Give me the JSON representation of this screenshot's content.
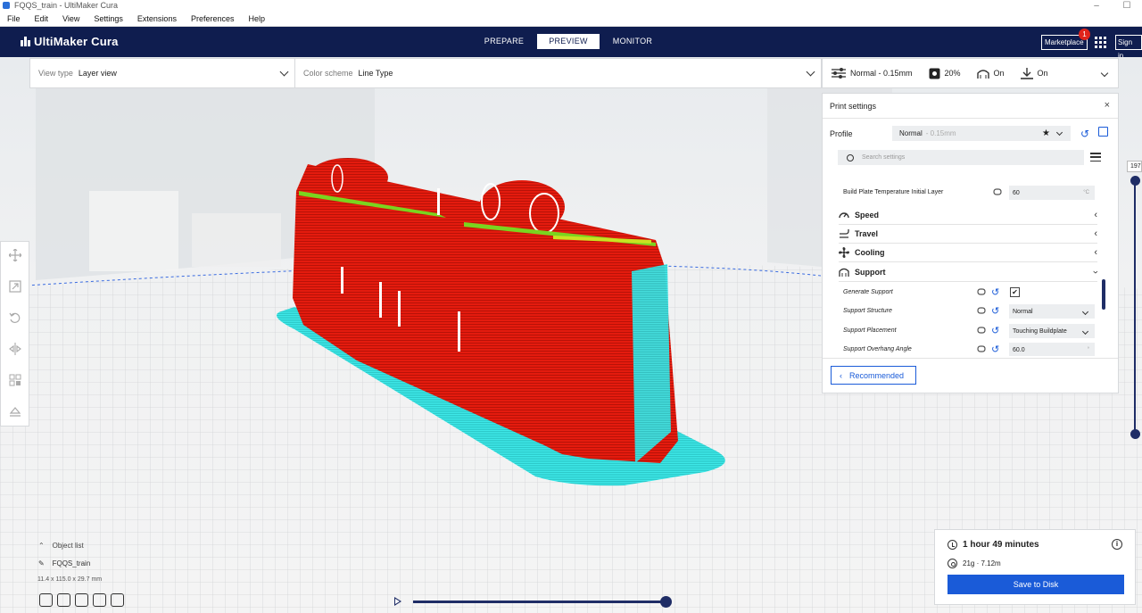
{
  "window": {
    "title": "FQQS_train - UltiMaker Cura",
    "controls": [
      "–",
      "☐"
    ]
  },
  "menu": [
    "File",
    "Edit",
    "View",
    "Settings",
    "Extensions",
    "Preferences",
    "Help"
  ],
  "header": {
    "logo": "UltiMaker Cura",
    "tabs": [
      "PREPARE",
      "PREVIEW",
      "MONITOR"
    ],
    "active_tab": "PREVIEW",
    "marketplace_label": "Marketplace",
    "marketplace_badge": "1",
    "signin_label": "Sign in"
  },
  "viewbar": {
    "view_type_label": "View type",
    "view_type_value": "Layer view",
    "color_scheme_label": "Color scheme",
    "color_scheme_value": "Line Type"
  },
  "print_setup": {
    "profile": "Normal - 0.15mm",
    "infill": "20%",
    "support": "On",
    "adhesion": "On"
  },
  "print_settings": {
    "title": "Print settings",
    "close": "×",
    "profile_label": "Profile",
    "profile_value": "Normal",
    "profile_sub": "- 0.15mm",
    "search_placeholder": "Search settings",
    "build_plate_label": "Build Plate Temperature Initial Layer",
    "build_plate_value": "60",
    "build_plate_unit": "°C",
    "categories": [
      "Speed",
      "Travel",
      "Cooling",
      "Support"
    ],
    "generate_support_label": "Generate Support",
    "generate_support_checked": "✔",
    "support_structure_label": "Support Structure",
    "support_structure_value": "Normal",
    "support_placement_label": "Support Placement",
    "support_placement_value": "Touching Buildplate",
    "overhang_angle_label": "Support Overhang Angle",
    "overhang_angle_value": "60.0",
    "overhang_angle_unit": "°",
    "recommended_label": "Recommended"
  },
  "layer_slider": {
    "value": "197"
  },
  "object_list": {
    "label": "Object list",
    "object_name": "FQQS_train",
    "dimensions": "11.4 x 115.0 x 29.7 mm"
  },
  "summary": {
    "time": "1 hour 49 minutes",
    "material": "21g · 7.12m",
    "save_label": "Save to Disk"
  },
  "colors": {
    "header_bg": "#0f1d4f",
    "accent": "#1a5bd8",
    "model_red": "#e02010",
    "support_cyan": "#2ee6e6"
  }
}
